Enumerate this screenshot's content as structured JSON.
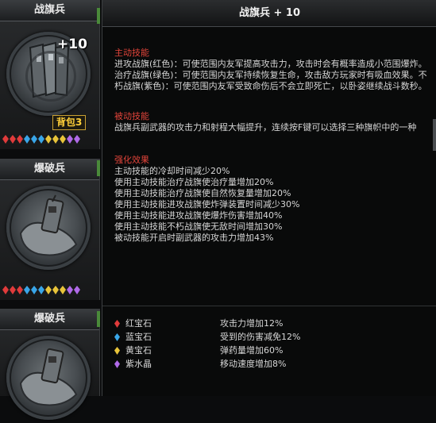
{
  "cards": [
    {
      "title": "战旗兵",
      "plus": "+10",
      "bag": "背包3"
    },
    {
      "title": "爆破兵"
    },
    {
      "title": "爆破兵"
    }
  ],
  "panel": {
    "title": "战旗兵 + 10",
    "active_head": "主动技能",
    "active_text": "进攻战旗(红色)：可使范围内友军提高攻击力，攻击时会有概率造成小范围爆炸。治疗战旗(绿色)：可使范围内友军持续恢复生命，攻击敌方玩家时有吸血效果。不朽战旗(紫色)：可使范围内友军受致命伤后不会立即死亡，以卧姿继续战斗数秒。",
    "passive_head": "被动技能",
    "passive_text": "战旗兵副武器的攻击力和射程大幅提升，连续按F键可以选择三种旗帜中的一种",
    "enhance_head": "强化效果",
    "enhance_lines": [
      "主动技能的冷却时间减少20%",
      "使用主动技能治疗战旗使治疗量增加20%",
      "使用主动技能治疗战旗使自然恢复量增加20%",
      "使用主动技能进攻战旗使炸弹装置时间减少30%",
      "使用主动技能进攻战旗使爆炸伤害增加40%",
      "使用主动技能不朽战旗使无敌时间增加30%",
      "被动技能开启时副武器的攻击力增加43%"
    ],
    "gems": [
      {
        "name": "红宝石",
        "effect": "攻击力增加12%",
        "color": "#e03b3b"
      },
      {
        "name": "蓝宝石",
        "effect": "受到的伤害减免12%",
        "color": "#39a6e8"
      },
      {
        "name": "黄宝石",
        "effect": "弹药量增加60%",
        "color": "#e8c43a"
      },
      {
        "name": "紫水晶",
        "effect": "移动速度增加8%",
        "color": "#b06ae8"
      }
    ]
  }
}
